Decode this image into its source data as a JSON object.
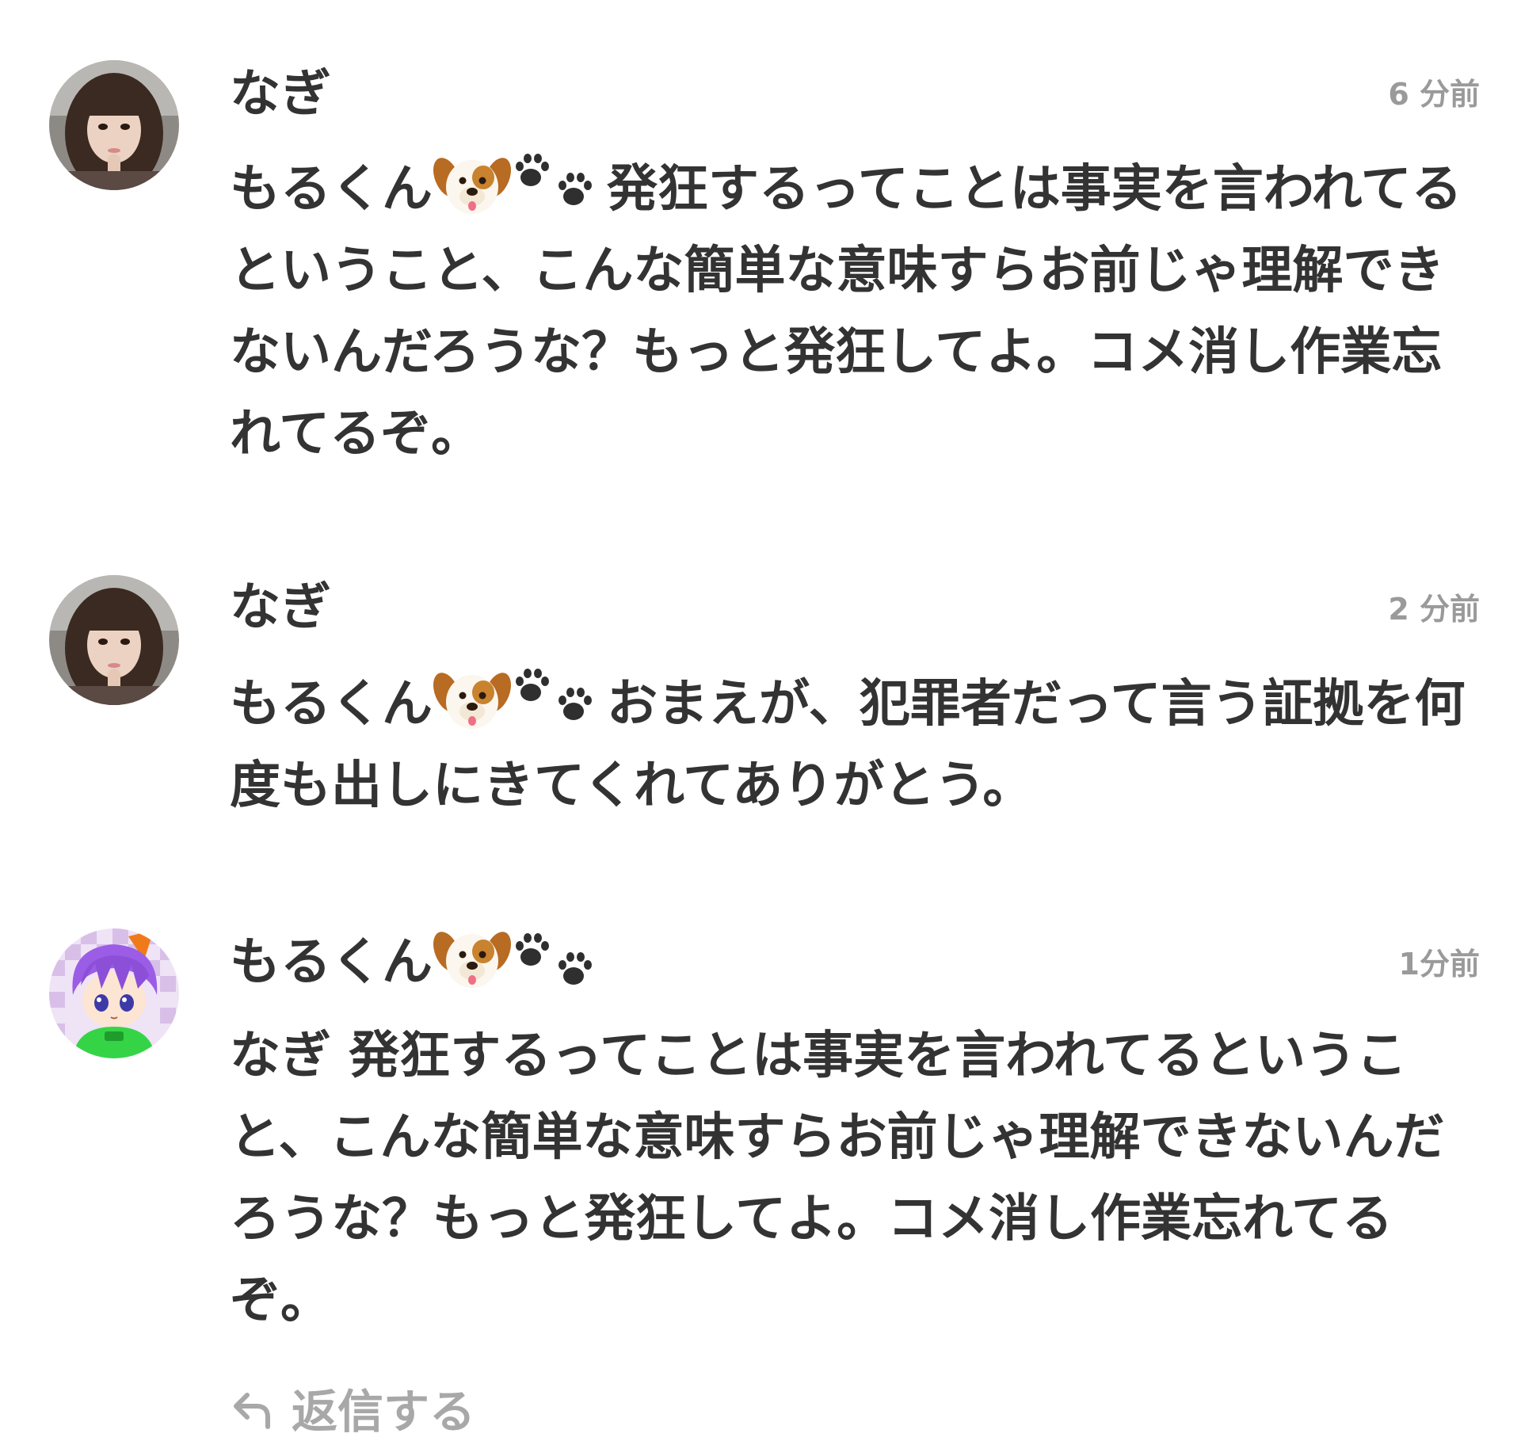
{
  "comments": [
    {
      "user": "なぎ",
      "time": "6 分前",
      "mention": "もるくん",
      "text": "発狂するってことは事実を言われてるということ、こんな簡単な意味すらお前じゃ理解できないんだろうな？もっと発狂してよ。コメ消し作業忘れてるぞ。",
      "avatar": "photo-avatar-icon"
    },
    {
      "user": "なぎ",
      "time": "2 分前",
      "mention": "もるくん",
      "text": "おまえが、犯罪者だって言う証拠を何度も出しにきてくれてありがとう。",
      "avatar": "photo-avatar-icon"
    },
    {
      "user": "もるくん",
      "time": "1分前",
      "text": "なぎ 発狂するってことは事実を言われてるということ、こんな簡単な意味すらお前じゃ理解できないんだろうな？もっと発狂してよ。コメ消し作業忘れてるぞ。",
      "avatar": "anime-avatar-icon"
    }
  ],
  "reply": {
    "label": "返信する",
    "icon": "reply-arrow-icon"
  },
  "colors": {
    "text": "#333333",
    "timestamp": "#9a9a9a",
    "reply": "#a8a8a8"
  }
}
